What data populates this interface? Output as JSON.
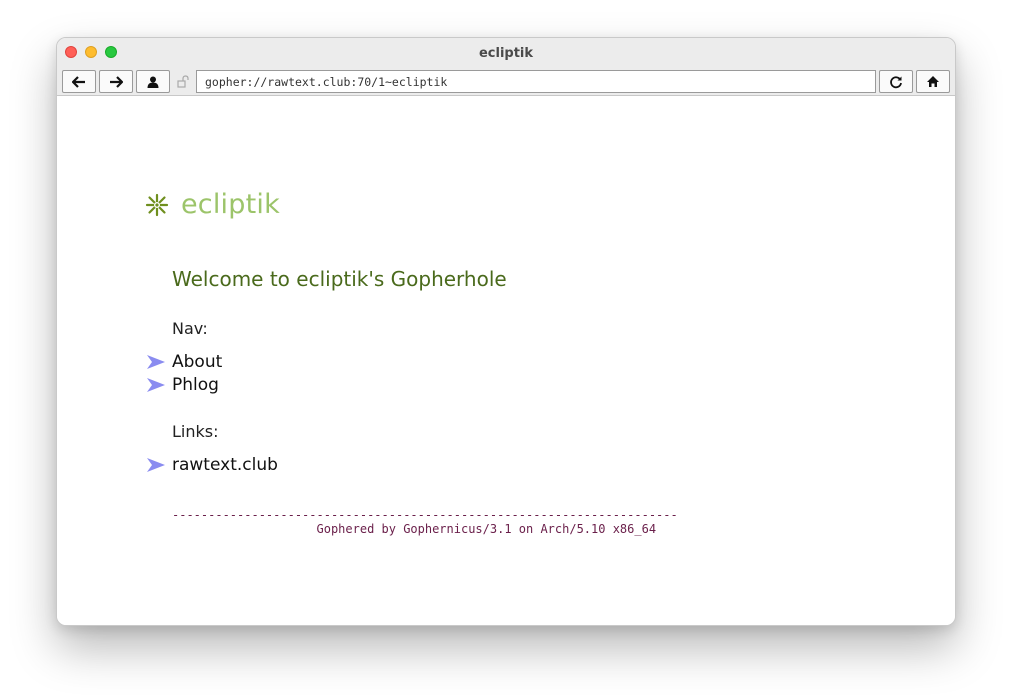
{
  "window": {
    "title": "ecliptik"
  },
  "toolbar": {
    "back_icon": "arrow-left-icon",
    "forward_icon": "arrow-right-icon",
    "identity_icon": "person-icon",
    "lock_icon": "unlock-icon",
    "url": "gopher://rawtext.club:70/1~ecliptik",
    "reload_icon": "reload-icon",
    "home_icon": "home-icon"
  },
  "page": {
    "brand": "ecliptik",
    "welcome": "Welcome to ecliptik's Gopherhole",
    "nav_label": "Nav:",
    "nav_items": [
      "About",
      "Phlog"
    ],
    "links_label": "Links:",
    "link_items": [
      "rawtext.club"
    ],
    "footer_rule": "----------------------------------------------------------------------",
    "footer_text": "                    Gophered by Gophernicus/3.1 on Arch/5.10 x86_64"
  },
  "colors": {
    "brand": "#9cc46a",
    "welcome": "#4a6a1c",
    "arrow": "#8a8cf0",
    "footer": "#6a1f4a"
  }
}
